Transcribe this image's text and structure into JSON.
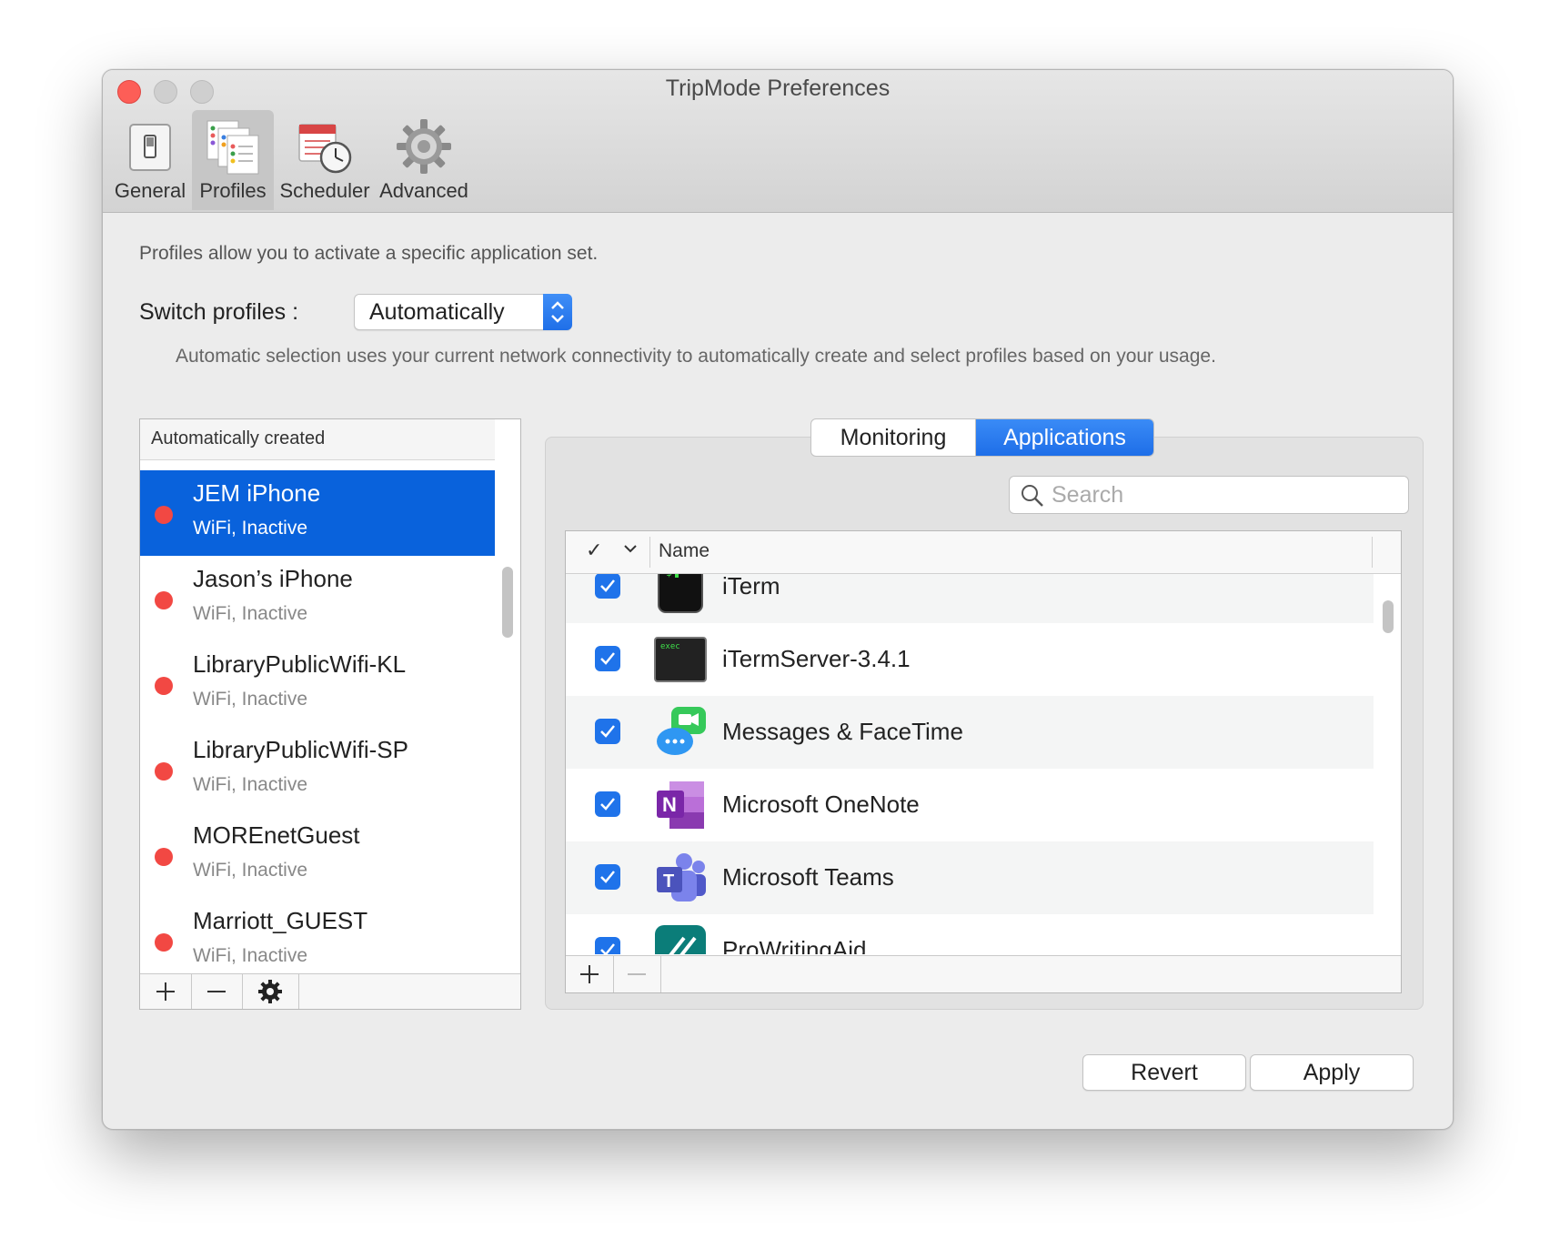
{
  "window": {
    "title": "TripMode Preferences"
  },
  "toolbar": {
    "items": [
      {
        "label": "General",
        "icon": "switch-icon"
      },
      {
        "label": "Profiles",
        "icon": "profiles-icon",
        "selected": true
      },
      {
        "label": "Scheduler",
        "icon": "calendar-clock-icon"
      },
      {
        "label": "Advanced",
        "icon": "gear-icon"
      }
    ]
  },
  "profiles_page": {
    "intro": "Profiles allow you to activate a specific application set.",
    "switch_label": "Switch profiles :",
    "switch_value": "Automatically",
    "auto_description": "Automatic selection uses your current network connectivity to automatically create and select profiles based on your usage."
  },
  "profile_list": {
    "header": "Automatically created",
    "items": [
      {
        "name": "JEM iPhone",
        "status": "WiFi, Inactive",
        "selected": true
      },
      {
        "name": "Jason’s iPhone",
        "status": "WiFi, Inactive"
      },
      {
        "name": "LibraryPublicWifi-KL",
        "status": "WiFi, Inactive"
      },
      {
        "name": "LibraryPublicWifi-SP",
        "status": "WiFi, Inactive"
      },
      {
        "name": "MOREnetGuest",
        "status": "WiFi, Inactive"
      },
      {
        "name": "Marriott_GUEST",
        "status": "WiFi, Inactive"
      }
    ],
    "status_dot_color": "#f24843",
    "selected_color": "#0962dc"
  },
  "tabs": {
    "monitoring": "Monitoring",
    "applications": "Applications",
    "selected": "Applications"
  },
  "search": {
    "placeholder": "Search"
  },
  "apps_table": {
    "header_check": "✓",
    "header_name": "Name",
    "rows": [
      {
        "name": "iTerm",
        "checked": true,
        "icon": "iterm-icon"
      },
      {
        "name": "iTermServer-3.4.1",
        "checked": true,
        "icon": "terminal-exec-icon"
      },
      {
        "name": "Messages & FaceTime",
        "checked": true,
        "icon": "messages-facetime-icon"
      },
      {
        "name": "Microsoft OneNote",
        "checked": true,
        "icon": "onenote-icon"
      },
      {
        "name": "Microsoft Teams",
        "checked": true,
        "icon": "teams-icon"
      },
      {
        "name": "ProWritingAid",
        "checked": true,
        "icon": "prowritingaid-icon"
      }
    ]
  },
  "buttons": {
    "revert": "Revert",
    "apply": "Apply"
  },
  "colors": {
    "accent": "#1f73ea",
    "window_bg": "#ececec"
  }
}
